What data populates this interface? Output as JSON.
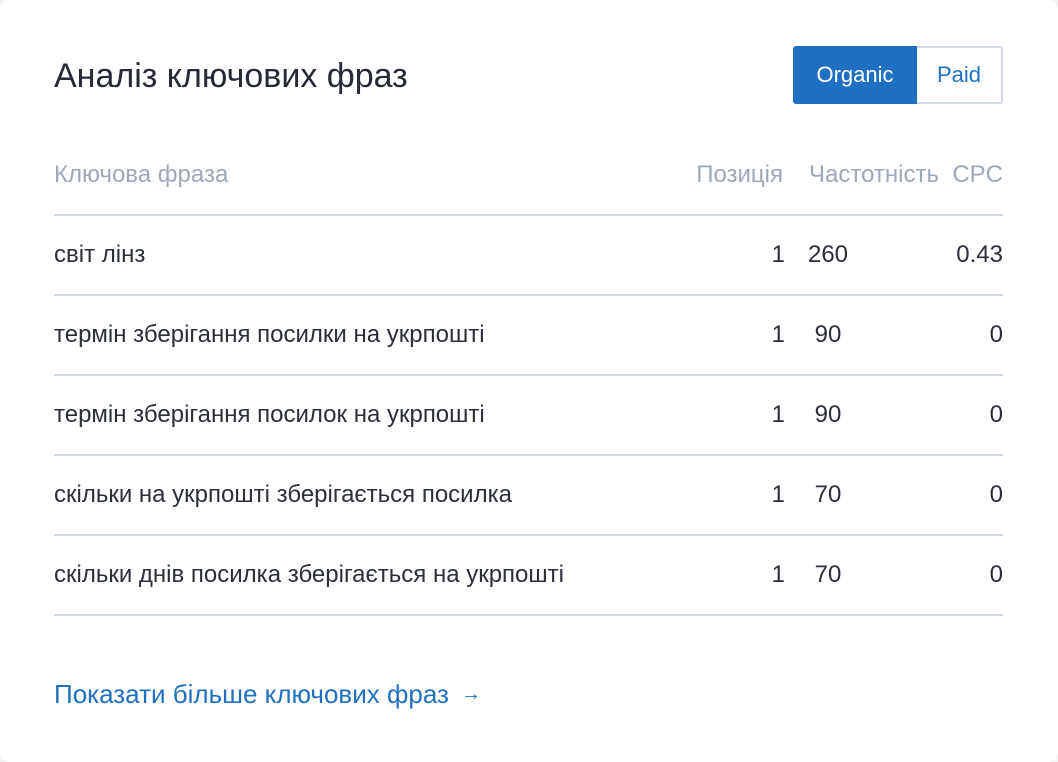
{
  "widget": {
    "title": "Аналіз ключових фраз",
    "toggle": {
      "organic_label": "Organic",
      "paid_label": "Paid",
      "selected": "Organic"
    },
    "table": {
      "columns": {
        "phrase": "Ключова фраза",
        "position": "Позиція",
        "frequency": "Частотність",
        "cpc": "CPC"
      },
      "rows": [
        {
          "phrase": "світ лінз",
          "position": "1",
          "frequency": "260",
          "cpc": "0.43"
        },
        {
          "phrase": "термін зберігання посилки на укрпошті",
          "position": "1",
          "frequency": "90",
          "cpc": "0"
        },
        {
          "phrase": "термін зберігання посилок на укрпошті",
          "position": "1",
          "frequency": "90",
          "cpc": "0"
        },
        {
          "phrase": "скільки на укрпошті зберігається посилка",
          "position": "1",
          "frequency": "70",
          "cpc": "0"
        },
        {
          "phrase": "скільки днів посилка зберігається на укрпошті",
          "position": "1",
          "frequency": "70",
          "cpc": "0"
        }
      ]
    },
    "more_link": {
      "label": "Показати більше ключових фраз",
      "icon": "arrow-right-icon",
      "glyph": "→"
    },
    "colors": {
      "accent": "#1f70c1",
      "text": "#252a36",
      "muted": "#9ea8b9",
      "divider": "#d3d9e2"
    }
  }
}
